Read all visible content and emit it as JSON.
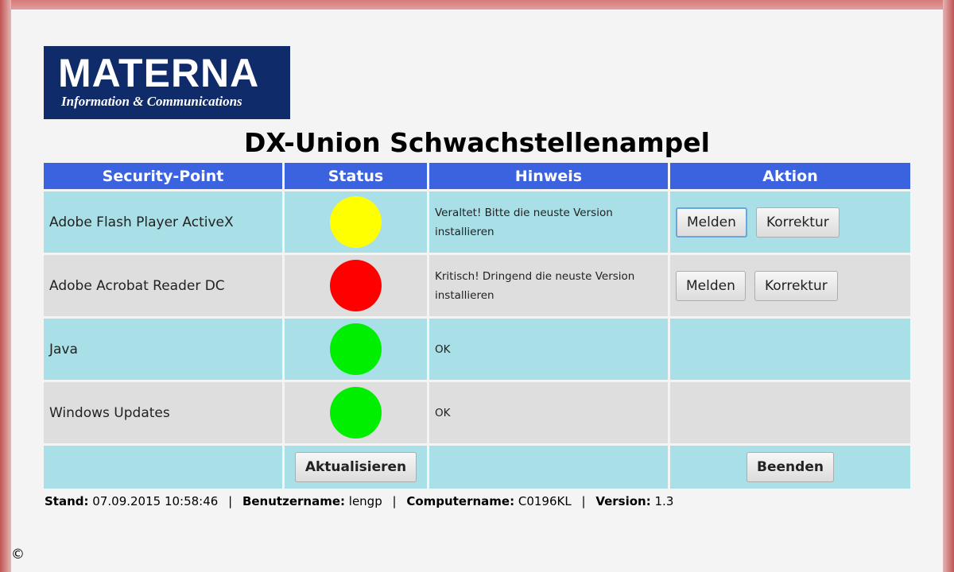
{
  "logo": {
    "name": "MATERNA",
    "subtitle": "Information & Communications",
    "background_color": "#0f2b69"
  },
  "title": "DX-Union Schwachstellenampel",
  "table": {
    "headers": [
      "Security-Point",
      "Status",
      "Hinweis",
      "Aktion"
    ],
    "rows": [
      {
        "name": "Adobe Flash Player ActiveX",
        "status": "yellow",
        "status_color": "#ffff00",
        "hint_line1": "Veraltet! Bitte die neuste Version",
        "hint_line2": "installieren",
        "actions": [
          "Melden",
          "Korrektur"
        ]
      },
      {
        "name": "Adobe Acrobat Reader DC",
        "status": "red",
        "status_color": "#ff0000",
        "hint_line1": "Kritisch! Dringend die neuste Version",
        "hint_line2": "installieren",
        "actions": [
          "Melden",
          "Korrektur"
        ]
      },
      {
        "name": "Java",
        "status": "green",
        "status_color": "#00ee00",
        "hint_line1": "OK"
      },
      {
        "name": "Windows Updates",
        "status": "green",
        "status_color": "#00ee00",
        "hint_line1": "OK"
      }
    ],
    "footer": {
      "refresh_label": "Aktualisieren",
      "exit_label": "Beenden"
    }
  },
  "statusbar": {
    "stand_label": "Stand:",
    "stand_value": "07.09.2015 10:58:46",
    "user_label": "Benutzername:",
    "user_value": "lengp",
    "computer_label": "Computername:",
    "computer_value": "C0196KL",
    "version_label": "Version:",
    "version_value": "1.3",
    "separator": "|"
  },
  "copyright": "©",
  "colors": {
    "header_blue": "#3b63e0",
    "row_cyan": "#a9dfe6",
    "row_gray": "#dedede"
  }
}
